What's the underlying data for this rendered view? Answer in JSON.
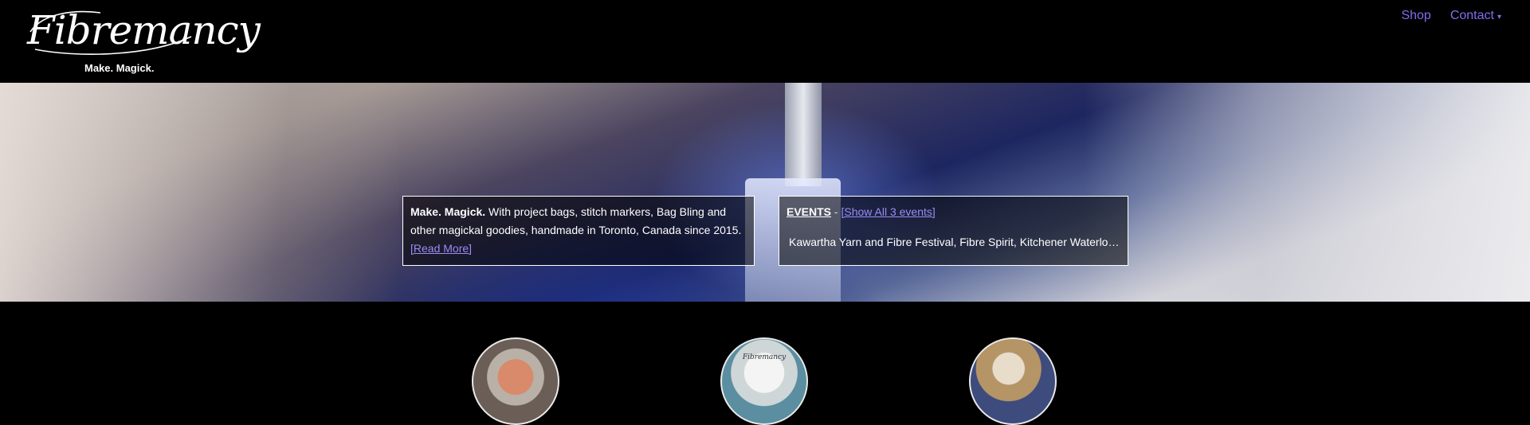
{
  "brand": {
    "name": "Fibremancy",
    "tagline": "Make. Magick."
  },
  "nav": {
    "items": [
      {
        "label": "Shop"
      },
      {
        "label": "Contact",
        "has_dropdown": true
      }
    ]
  },
  "hero": {
    "about": {
      "lead": "Make. Magick.",
      "text": " With project bags, stitch markers, Bag Bling and other magickal goodies, handmade in Toronto, Canada since 2015.",
      "link": "[Read More]"
    },
    "events": {
      "title": "EVENTS",
      "separator": " - ",
      "link": "[Show All 3 events]",
      "list": "Kawartha Yarn and Fibre Festival, Fibre Spirit, Kitchener Waterloo Knitters' Fibre Festival"
    }
  },
  "products": {
    "items": [
      {
        "name": "project-bags"
      },
      {
        "name": "stitch-markers",
        "label": "Fibremancy"
      },
      {
        "name": "bag-bling"
      }
    ]
  },
  "colors": {
    "background": "#000000",
    "nav_link": "#7d6ff0",
    "hero_link": "#9a8cf4",
    "box_border": "#ffffff"
  }
}
